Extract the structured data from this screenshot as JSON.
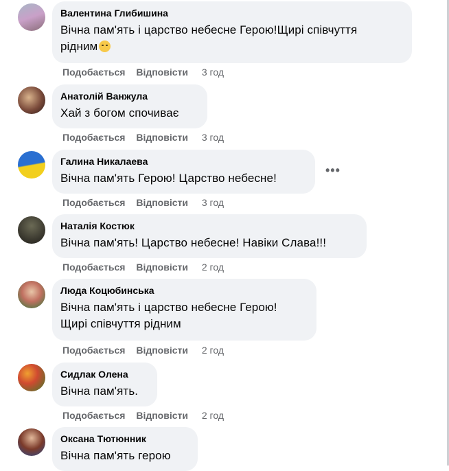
{
  "actions": {
    "like": "Подобається",
    "reply": "Відповісти"
  },
  "comments": [
    {
      "author": "Валентина Глибишина",
      "lines": [
        "Вічна пам'ять і царство небесне Герою!Щирі співчуття",
        "рідним"
      ],
      "emoji": "crying-face-emoji",
      "time": "3 год"
    },
    {
      "author": "Анатолій Ванжула",
      "lines": [
        "Хай з богом спочиває"
      ],
      "time": "3 год"
    },
    {
      "author": "Галина Никалаева",
      "lines": [
        "Вічна пам'ять Герою! Царство небесне!"
      ],
      "time": "3 год",
      "more": "•••"
    },
    {
      "author": "Наталія Костюк",
      "lines": [
        "Вічна пам'ять! Царство небесне! Навіки Слава!!!"
      ],
      "time": "2 год"
    },
    {
      "author": "Люда Коцюбинська",
      "lines": [
        "Вічна пам'ять і царство небесне Герою!",
        "Щирі співчуття рідним"
      ],
      "time": "2 год"
    },
    {
      "author": "Сидлак Олена",
      "lines": [
        "Вічна пам'ять."
      ],
      "time": "2 год"
    },
    {
      "author": "Оксана Тютюнник",
      "lines": [
        "Вічна пам'ять герою"
      ]
    }
  ]
}
